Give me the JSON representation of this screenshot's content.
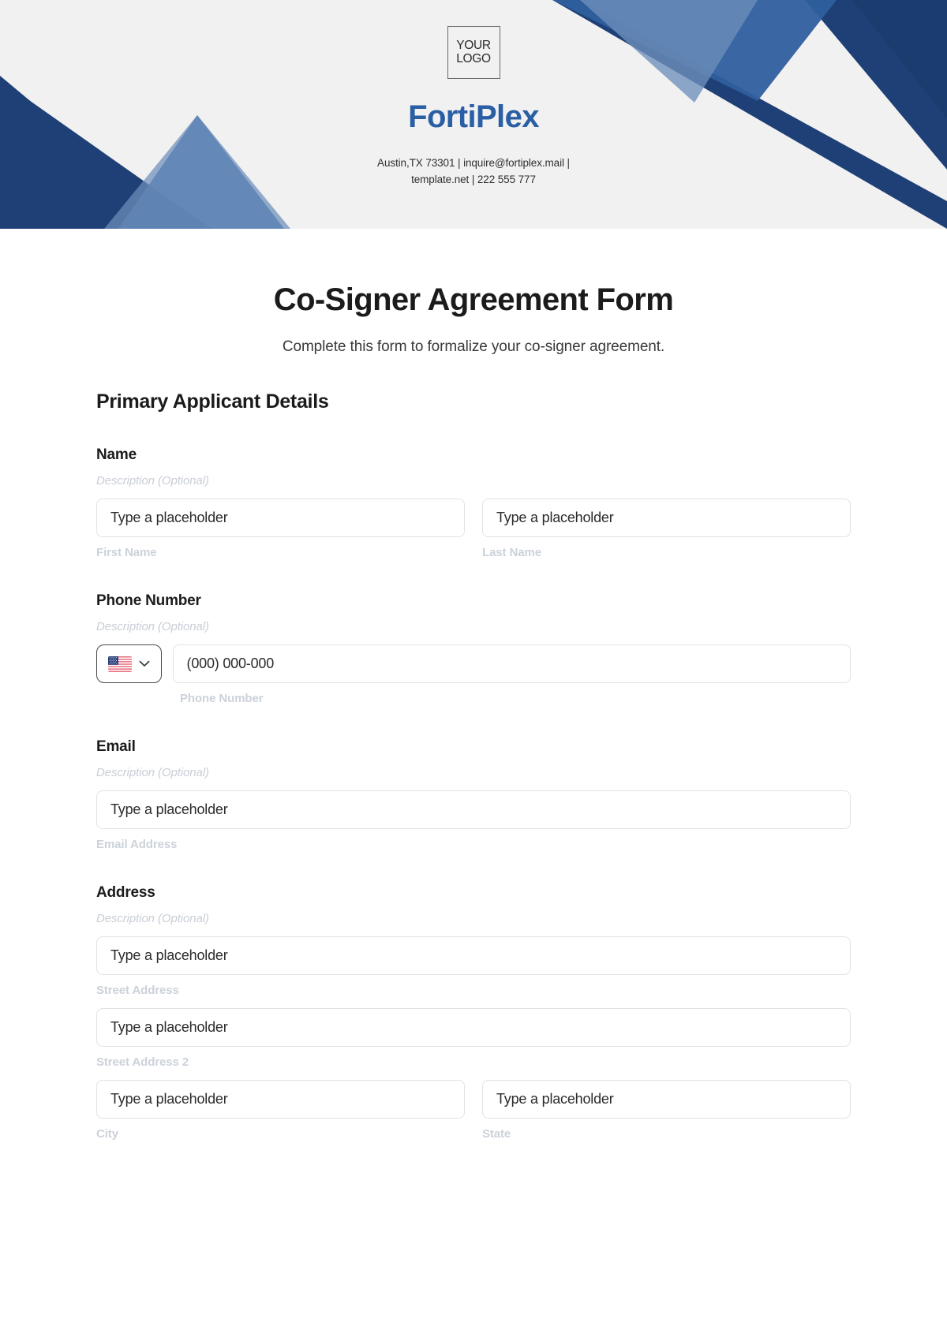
{
  "header": {
    "logo": {
      "line1": "YOUR",
      "line2": "LOGO",
      "icon": "logo-placeholder-box"
    },
    "brand_name": "FortiPlex",
    "contact_line1": "Austin,TX 73301 | inquire@fortiplex.mail |",
    "contact_line2": "template.net | 222 555 777",
    "colors": {
      "background": "#f1f1f1",
      "brand_blue": "#2a5fa5",
      "dark_navy": "#1e4076",
      "mid_blue": "#2f5f9e",
      "light_blue": "#6d8fbb"
    }
  },
  "form": {
    "title": "Co-Signer Agreement Form",
    "subtitle": "Complete this form to formalize your co-signer agreement.",
    "section_heading": "Primary Applicant Details",
    "description_text": "Description (Optional)",
    "placeholder": "Type a placeholder",
    "fields": {
      "name": {
        "label": "Name",
        "description": "Description (Optional)",
        "first": {
          "placeholder": "Type a placeholder",
          "sub_label": "First Name"
        },
        "last": {
          "placeholder": "Type a placeholder",
          "sub_label": "Last Name"
        }
      },
      "phone": {
        "label": "Phone Number",
        "description": "Description (Optional)",
        "country_flag": "us-flag-icon",
        "country_chevron": "chevron-down-icon",
        "placeholder": "(000) 000-000",
        "sub_label": "Phone Number"
      },
      "email": {
        "label": "Email",
        "description": "Description (Optional)",
        "placeholder": "Type a placeholder",
        "sub_label": "Email Address"
      },
      "address": {
        "label": "Address",
        "description": "Description (Optional)",
        "street1": {
          "placeholder": "Type a placeholder",
          "sub_label": "Street Address"
        },
        "street2": {
          "placeholder": "Type a placeholder",
          "sub_label": "Street Address 2"
        },
        "city": {
          "placeholder": "Type a placeholder",
          "sub_label": "City"
        },
        "state": {
          "placeholder": "Type a placeholder",
          "sub_label": "State"
        }
      }
    }
  }
}
